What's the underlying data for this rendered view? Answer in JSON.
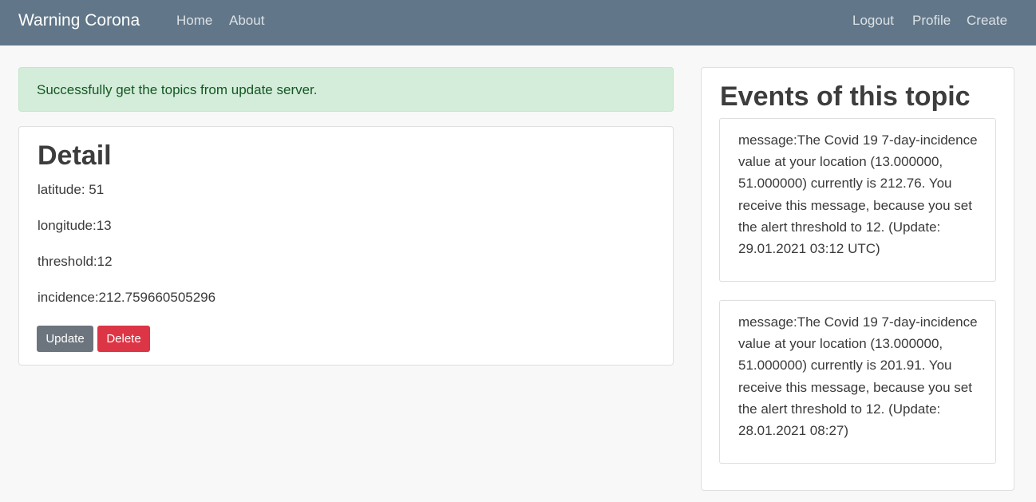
{
  "navbar": {
    "brand": "Warning Corona",
    "left_links": [
      "Home",
      "About"
    ],
    "right_links": [
      "Logout",
      "Profile",
      "Create"
    ]
  },
  "alert": {
    "text": "Successfully get the topics from update server."
  },
  "detail": {
    "title": "Detail",
    "latitude": "latitude: 51",
    "longitude": "longitude:13",
    "threshold": "threshold:12",
    "incidence": "incidence:212.759660505296",
    "update_label": "Update",
    "delete_label": "Delete"
  },
  "events": {
    "title": "Events of this topic",
    "items": [
      "message:The Covid 19 7-day-incidence value at your location (13.000000, 51.000000) currently is 212.76. You receive this message, because you set the alert threshold to 12. (Update: 29.01.2021 03:12 UTC)",
      "message:The Covid 19 7-day-incidence value at your location (13.000000, 51.000000) currently is 201.91. You receive this message, because you set the alert threshold to 12. (Update: 28.01.2021 08:27)"
    ]
  },
  "colors": {
    "navbar": "#617789",
    "alert_bg": "#d4edda",
    "alert_text": "#155724",
    "update_button": "#6c757d",
    "delete_button": "#dc3545"
  }
}
